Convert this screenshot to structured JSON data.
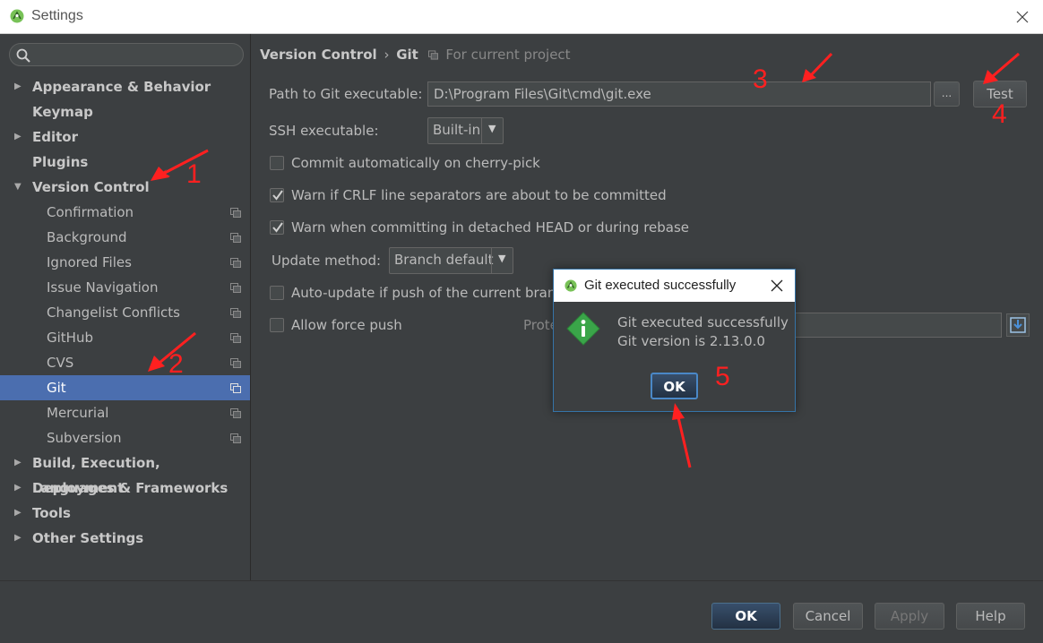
{
  "window": {
    "title": "Settings"
  },
  "search": {
    "placeholder": ""
  },
  "sidebar": {
    "items": [
      {
        "label": "Appearance & Behavior"
      },
      {
        "label": "Keymap"
      },
      {
        "label": "Editor"
      },
      {
        "label": "Plugins"
      },
      {
        "label": "Version Control"
      },
      {
        "label": "Confirmation"
      },
      {
        "label": "Background"
      },
      {
        "label": "Ignored Files"
      },
      {
        "label": "Issue Navigation"
      },
      {
        "label": "Changelist Conflicts"
      },
      {
        "label": "GitHub"
      },
      {
        "label": "CVS"
      },
      {
        "label": "Git"
      },
      {
        "label": "Mercurial"
      },
      {
        "label": "Subversion"
      },
      {
        "label": "Build, Execution, Deployment"
      },
      {
        "label": "Languages & Frameworks"
      },
      {
        "label": "Tools"
      },
      {
        "label": "Other Settings"
      }
    ]
  },
  "breadcrumb": {
    "parent": "Version Control",
    "separator": "›",
    "current": "Git",
    "scope": "For current project"
  },
  "git": {
    "path_label": "Path to Git executable:",
    "path_value": "D:\\Program Files\\Git\\cmd\\git.exe",
    "browse_label": "...",
    "test_label": "Test",
    "ssh_label": "SSH executable:",
    "ssh_value": "Built-in",
    "cherry_pick_label": "Commit automatically on cherry-pick",
    "cherry_pick_checked": false,
    "crlf_label": "Warn if CRLF line separators are about to be committed",
    "crlf_checked": true,
    "detached_label": "Warn when committing in detached HEAD or during rebase",
    "detached_checked": true,
    "update_method_label": "Update method:",
    "update_method_value": "Branch default",
    "auto_update_label": "Auto-update if push of the current branch",
    "auto_update_checked": false,
    "force_push_label": "Allow force push",
    "force_push_checked": false,
    "protected_label": "Prote"
  },
  "dialog": {
    "title": "Git executed successfully",
    "message_line1": "Git executed successfully",
    "message_line2": "Git version is 2.13.0.0",
    "ok_label": "OK"
  },
  "footer": {
    "ok_label": "OK",
    "cancel_label": "Cancel",
    "apply_label": "Apply",
    "help_label": "Help"
  },
  "annotations": [
    "1",
    "2",
    "3",
    "4",
    "5"
  ],
  "colors": {
    "background": "#3c3f41",
    "selection": "#4b6eaf",
    "annotation": "#ff2020",
    "dialog_border": "#3574a8",
    "info_icon": "#3aa549"
  }
}
